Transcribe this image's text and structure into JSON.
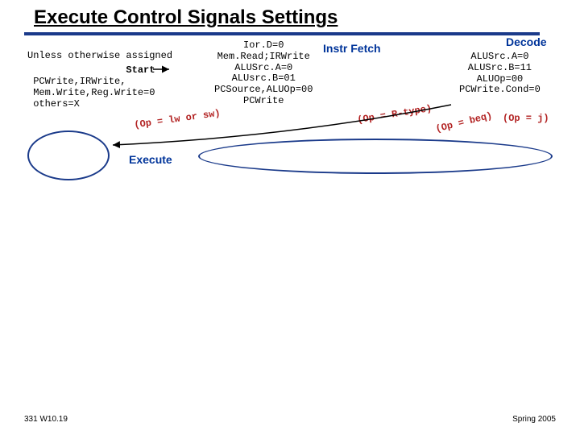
{
  "title": "Execute Control Signals Settings",
  "note_line1": "Unless otherwise assigned",
  "note_start": "                 Start",
  "note_line3": " PCWrite,IRWrite,",
  "note_line4": " Mem.Write,Reg.Write=0",
  "note_line5": " others=X",
  "label_instr_fetch": "Instr Fetch",
  "label_decode": "Decode",
  "label_execute": "Execute",
  "fetch_signals": "Ior.D=0\nMem.Read;IRWrite\nALUSrc.A=0\nALUsrc.B=01\nPCSource,ALUOp=00\nPCWrite",
  "decode_signals": "ALUSrc.A=0\nALUSrc.B=11\nALUOp=00\nPCWrite.Cond=0",
  "branch_lw_sw": "(Op = lw or sw)",
  "branch_rtype": "(Op = R-type)",
  "branch_beq": "(Op = beq)",
  "branch_j": "(Op = j)",
  "footer_left": "331 W10.19",
  "footer_right": "Spring 2005"
}
